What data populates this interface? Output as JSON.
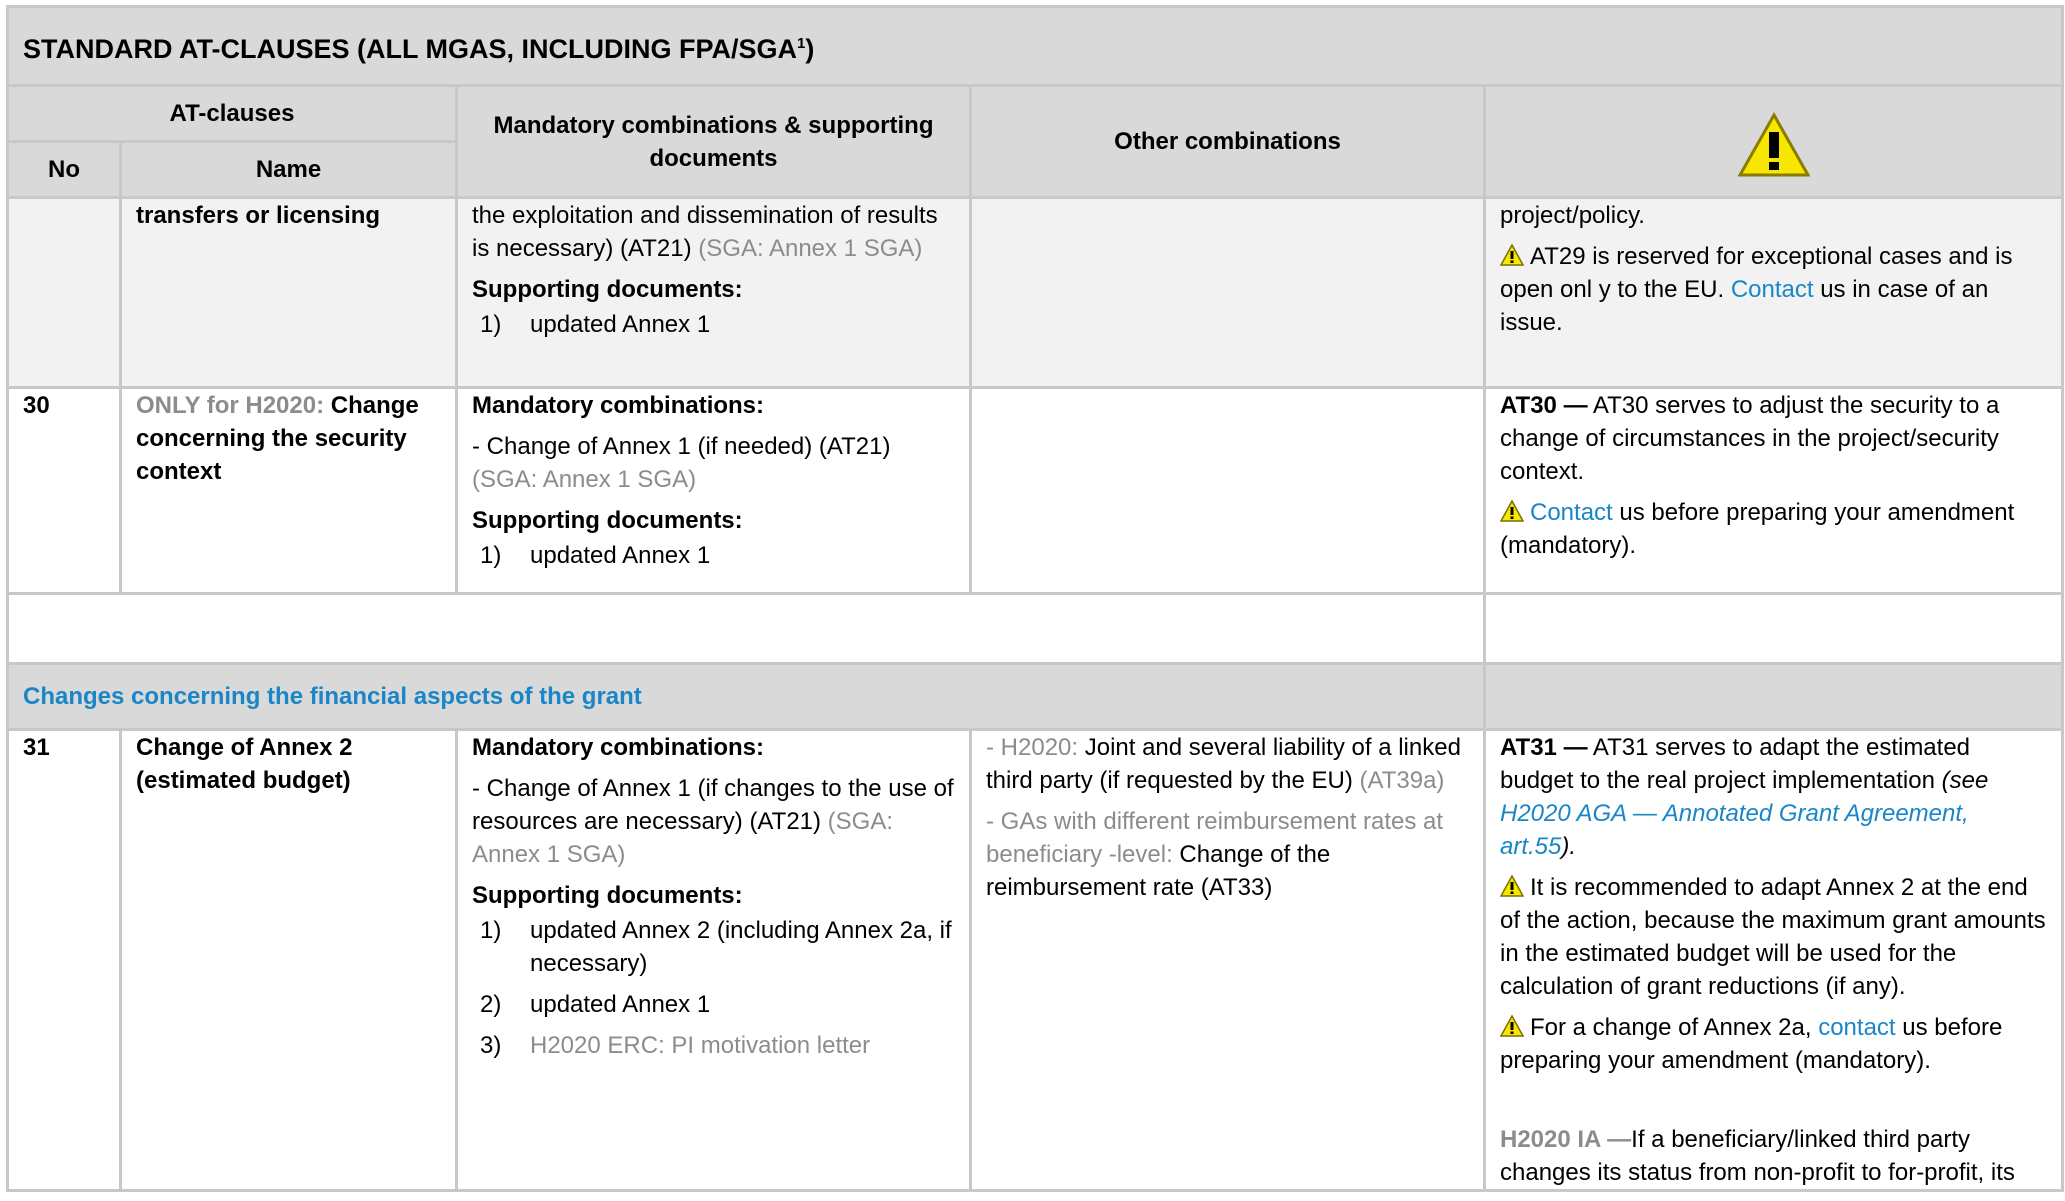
{
  "title": {
    "text": "STANDARD AT-CLAUSES (ALL MGAS, INCLUDING FPA/SGA",
    "sup": "1",
    "close": ")"
  },
  "headers": {
    "at_clauses": "AT-clauses",
    "no": "No",
    "name": "Name",
    "mandatory": "Mandatory combinations & supporting documents",
    "other": "Other combinations",
    "warning_icon": "warning-icon"
  },
  "row29": {
    "name": "transfers or licensing",
    "mand_line1": "the exploitation and dissemination of results is necessary) (AT21)",
    "mand_line1_grey": " (SGA: Annex 1 SGA)",
    "supporting_label": "Supporting documents:",
    "docs": [
      {
        "num": "1)",
        "text": "updated Annex 1"
      }
    ],
    "notes_line1": "project/policy.",
    "notes_warn_a": "AT29 is reserved for exceptional cases and is open onl y to the EU. ",
    "notes_warn_link": "Contact",
    "notes_warn_b": " us in case of an issue."
  },
  "row30": {
    "no": "30",
    "name_grey": "ONLY for H2020: ",
    "name": "Change concerning the security context",
    "mand_label": "Mandatory combinations:",
    "mand_text": "- Change of Annex 1 (if needed) (AT21)",
    "mand_grey": "(SGA: Annex 1 SGA)",
    "supporting_label": "Supporting documents:",
    "docs": [
      {
        "num": "1)",
        "text": "updated Annex 1"
      }
    ],
    "notes_bold": "AT30 —",
    "notes_text": " AT30 serves to adjust the security to a change of circumstances in the project/security context.",
    "notes_warn_link": "Contact",
    "notes_warn_text": " us before preparing your amendment (mandatory)."
  },
  "section": {
    "label": "Changes concerning the financial aspects of the grant"
  },
  "row31": {
    "no": "31",
    "name": "Change of Annex 2 (estimated budget)",
    "mand_label": "Mandatory combinations:",
    "mand_text": "- Change of Annex 1 (if changes to the use of resources are necessary) (AT21)",
    "mand_grey": " (SGA: Annex 1 SGA)",
    "supporting_label": "Supporting documents:",
    "docs": [
      {
        "num": "1)",
        "text": "updated Annex 2 (including Annex 2a, if necessary)",
        "grey": false
      },
      {
        "num": "2)",
        "text": "updated Annex 1",
        "grey": false
      },
      {
        "num": "3)",
        "text": "H2020 ERC: PI motivation letter",
        "grey": true
      }
    ],
    "other1_grey": "- H2020: ",
    "other1_text": "Joint and several liability of a linked third party (if requested by the EU)",
    "other1_grey2": " (AT39a)",
    "other2_grey": "- GAs with different reimbursement rates at beneficiary -level: ",
    "other2_text": "Change of the reimbursement rate (AT33)",
    "notes_bold": "AT31 —",
    "notes_text": " AT31 serves to adapt the estimated budget to the real project implementation ",
    "notes_italic_a": "(see ",
    "notes_link": "H2020 AGA — Annotated Grant Agreement, art.55",
    "notes_italic_b": ").",
    "notes_warn1": "It is recommended to adapt Annex 2 at the end of the action, because the maximum grant amounts in the estimated budget will be used for the calculation of grant reductions (if any).",
    "notes_warn2_a": "For a change of Annex 2a, ",
    "notes_warn2_link": "contact",
    "notes_warn2_b": " us before preparing your amendment (mandatory).",
    "notes_ia_grey": "H2020 IA —",
    "notes_ia_text": "If a beneficiary/linked third party changes its status from non-profit to for-profit, its"
  }
}
